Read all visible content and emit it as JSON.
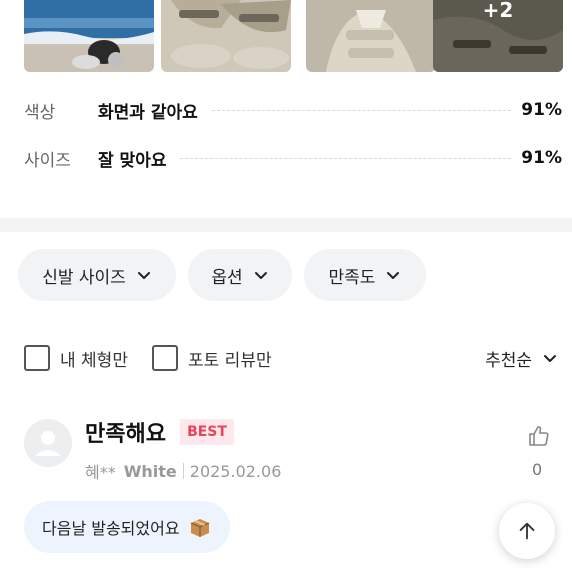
{
  "photos": {
    "more_label": "+2"
  },
  "ratings": [
    {
      "key": "색상",
      "value": "화면과 같아요",
      "percent": "91%"
    },
    {
      "key": "사이즈",
      "value": "잘 맞아요",
      "percent": "91%"
    }
  ],
  "filters": {
    "shoe_size": "신발 사이즈",
    "option": "옵션",
    "satisfaction": "만족도"
  },
  "checks": {
    "my_size": "내 체형만",
    "photo_review": "포토 리뷰만"
  },
  "sort": {
    "label": "추천순"
  },
  "review": {
    "title": "만족해요",
    "badge": "BEST",
    "author": "혜**",
    "option": "White",
    "date": "2025.02.06",
    "likes": "0",
    "tag": "다음날 발송되었어요"
  },
  "colors": {
    "accent_pink": "#e8445a",
    "badge_bg": "#fde8ec",
    "chip_bg": "#f2f3f5",
    "tag_bg": "#eef4fe"
  },
  "icons": [
    "chevron-down-icon",
    "thumbs-up-icon",
    "box-icon",
    "arrow-up-icon",
    "user-icon"
  ]
}
